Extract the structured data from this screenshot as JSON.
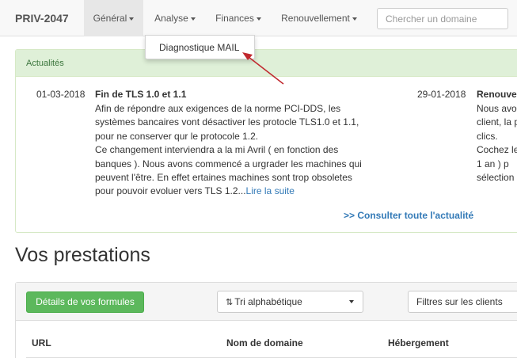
{
  "navbar": {
    "brand": "PRIV-2047",
    "menus": [
      "Général",
      "Analyse",
      "Finances",
      "Renouvellement"
    ],
    "search_placeholder": "Chercher un domaine"
  },
  "dropdown": {
    "items": [
      "Diagnostique MAIL"
    ]
  },
  "news": {
    "heading": "Actualités",
    "items": [
      {
        "date": "01-03-2018",
        "title": "Fin de TLS 1.0 et 1.1",
        "lines": [
          "Afin de répondre aux exigences de la norme PCI-DDS, les",
          "systèmes bancaires vont désactiver les protocle TLS1.0 et 1.1,",
          "pour ne conserver qur le protocole 1.2.",
          "Ce changement interviendra a la mi Avril ( en fonction des",
          "banques ). Nous avons commencé a urgrader les machines qui",
          "peuvent l'être. En effet ertaines machines sont trop obsoletes",
          "pour pouvoir evoluer vers TLS 1.2..."
        ],
        "read_more": "Lire la suite"
      },
      {
        "date": "29-01-2018",
        "title": "Renouve",
        "lines": [
          "Nous avo",
          "client, la p",
          "clics.",
          "Cochez le",
          "1 an ) p",
          "sélection"
        ]
      }
    ],
    "see_all": ">> Consulter toute l'actualité"
  },
  "prestations": {
    "title": "Vos prestations",
    "details_button": "Détails de vos formules",
    "sort_select": "Tri alphabétique",
    "filter_select": "Filtres sur les clients",
    "columns": [
      "URL",
      "Nom de domaine",
      "Hébergement"
    ]
  },
  "colors": {
    "accent_green": "#5cb85c",
    "panel_heading_bg": "#dff0d8",
    "link_blue": "#337ab7",
    "arrow_red": "#c0272d"
  }
}
